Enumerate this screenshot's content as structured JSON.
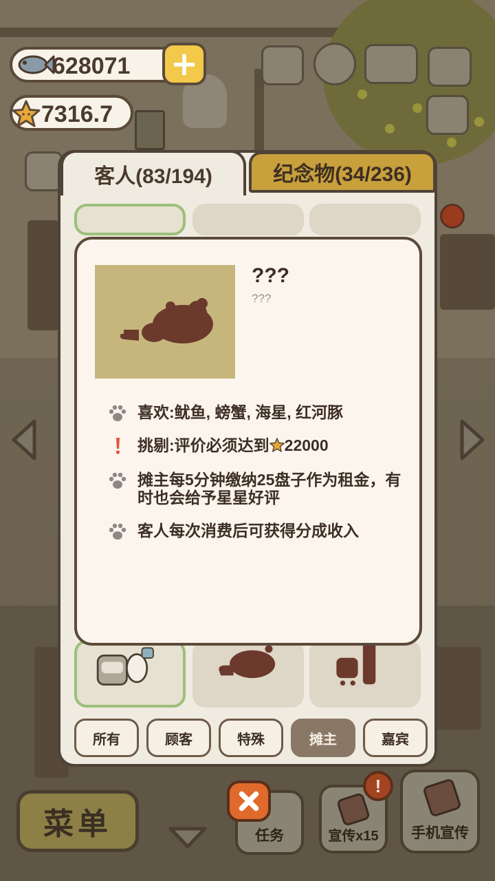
{
  "currencies": {
    "fish": "628071",
    "stars": "7316.7"
  },
  "tabs": {
    "guests": "客人(83/194)",
    "souvenirs": "纪念物(34/236)"
  },
  "detail": {
    "name": "???",
    "subname": "???",
    "traits": [
      {
        "icon": "paw-icon",
        "text": "喜欢:鱿鱼, 螃蟹, 海星, 红河豚"
      },
      {
        "icon": "exclamation-icon",
        "text_prefix": "挑剔:评价必须达到",
        "text_value": "22000"
      },
      {
        "icon": "paw-icon",
        "text": "摊主每5分钟缴纳25盘子作为租金，有时也会给予星星好评"
      },
      {
        "icon": "paw-icon",
        "text": "客人每次消费后可获得分成收入"
      }
    ]
  },
  "filters": [
    {
      "label": "所有",
      "active": false
    },
    {
      "label": "顾客",
      "active": false
    },
    {
      "label": "特殊",
      "active": false
    },
    {
      "label": "摊主",
      "active": true
    },
    {
      "label": "嘉宾",
      "active": false
    }
  ],
  "hud": {
    "menu": "菜单",
    "tasks": "任务",
    "promo": "宣传x15",
    "promo_alert": "!",
    "phone_promo": "手机宣传"
  },
  "colors": {
    "panel": "#f0ebe0",
    "accent_gold": "#c8a03c",
    "active_filter": "#8a7866",
    "close_orange": "#e06a2c",
    "portrait_bg": "#c7b67c",
    "silhouette": "#6b3a2c"
  }
}
